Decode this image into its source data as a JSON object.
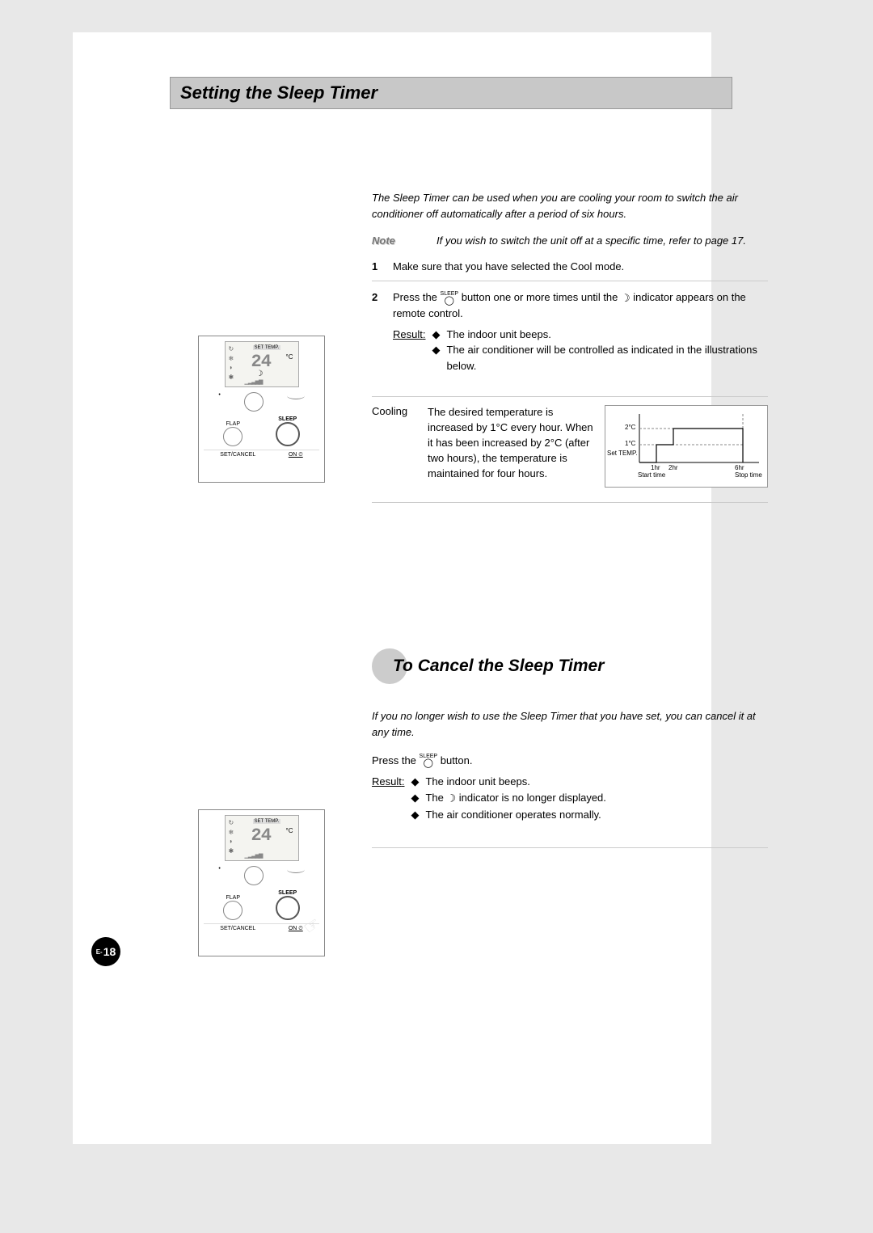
{
  "section1": {
    "title": "Setting the Sleep Timer",
    "intro": "The Sleep Timer can be used when you are cooling your room to switch the air conditioner off automatically after a period of six hours.",
    "note_label": "Note",
    "note_body": "If you wish to switch the unit off at a specific time, refer to page 17.",
    "step1_num": "1",
    "step1": "Make sure that you have selected the Cool mode.",
    "step2_num": "2",
    "step2_a": "Press the ",
    "step2_b": " button one or more times until the ",
    "step2_c": " indicator appears on the remote control.",
    "result_label": "Result",
    "result_b1": "The indoor unit beeps.",
    "result_b2": "The air conditioner will be controlled as indicated in the illustrations below."
  },
  "cooling": {
    "label": "Cooling",
    "text": "The desired temperature is increased by 1°C every hour. When it has been increased by 2°C (after two hours), the temperature is maintained for four hours."
  },
  "chart_data": {
    "type": "line",
    "title": "",
    "xlabel": "",
    "ylabel": "Set TEMP.",
    "y_ticks": [
      "1°C",
      "2°C"
    ],
    "x_ticks": [
      "1hr",
      "2hr",
      "6hr"
    ],
    "annotations": {
      "start": "Start time",
      "stop": "Stop time"
    },
    "x": [
      0,
      1,
      2,
      6
    ],
    "values": [
      0,
      1,
      2,
      2
    ],
    "xlim": [
      0,
      6
    ],
    "ylim": [
      0,
      2.5
    ]
  },
  "section2": {
    "title": "To Cancel the Sleep Timer",
    "intro": "If you no longer wish to use the Sleep Timer that you have set, you can cancel it at any time.",
    "press_a": "Press the ",
    "press_b": " button.",
    "result_label": "Result",
    "b1": "The indoor unit beeps.",
    "b2_a": "The ",
    "b2_b": " indicator is no longer displayed.",
    "b3": "The air conditioner operates normally."
  },
  "remote": {
    "settemp": "SET TEMP.",
    "digits": "24",
    "unit": "°C",
    "flap": "FLAP",
    "sleep": "SLEEP",
    "setcancel": "SET/CANCEL",
    "on": "ON ⏲"
  },
  "icons": {
    "sleep_label": "SLEEP",
    "moon": "☽",
    "diamond": "◆"
  },
  "page_num_prefix": "E-",
  "page_num": "18"
}
